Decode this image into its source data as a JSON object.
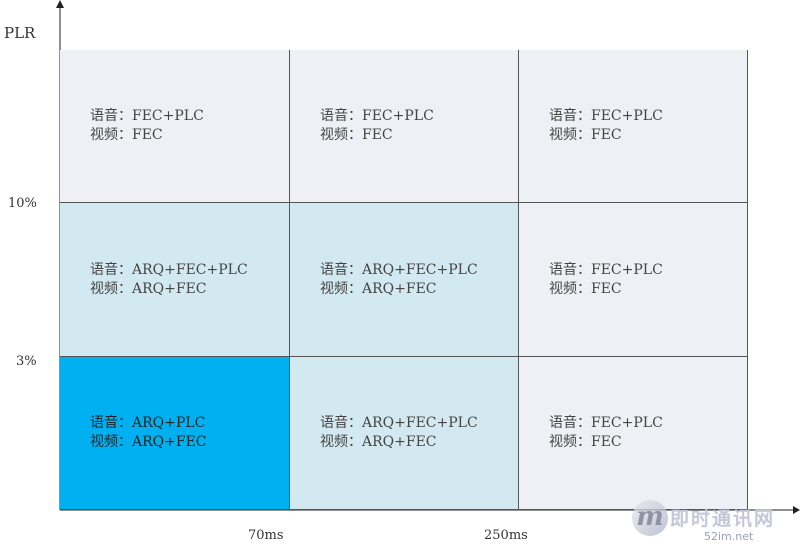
{
  "axes": {
    "y_title": "PLR",
    "y_ticks": [
      "10%",
      "3%"
    ],
    "x_ticks": [
      "70ms",
      "250ms"
    ]
  },
  "cells": [
    {
      "row": 0,
      "col": 0,
      "line1": "语音：FEC+PLC",
      "line2": "视频：FEC",
      "color": "#eef0f5"
    },
    {
      "row": 0,
      "col": 1,
      "line1": "语音：FEC+PLC",
      "line2": "视频：FEC",
      "color": "#eef0f5"
    },
    {
      "row": 0,
      "col": 2,
      "line1": "语音：FEC+PLC",
      "line2": "视频：FEC",
      "color": "#eef0f5"
    },
    {
      "row": 1,
      "col": 0,
      "line1": "语音：ARQ+FEC+PLC",
      "line2": "视频：ARQ+FEC",
      "color": "#d3e9f1"
    },
    {
      "row": 1,
      "col": 1,
      "line1": "语音：ARQ+FEC+PLC",
      "line2": "视频：ARQ+FEC",
      "color": "#d3e9f1"
    },
    {
      "row": 1,
      "col": 2,
      "line1": "语音：FEC+PLC",
      "line2": "视频：FEC",
      "color": "#eef0f5"
    },
    {
      "row": 2,
      "col": 0,
      "line1": "语音：ARQ+PLC",
      "line2": "视频：ARQ+FEC",
      "color": "#00b0f0"
    },
    {
      "row": 2,
      "col": 1,
      "line1": "语音：ARQ+FEC+PLC",
      "line2": "视频：ARQ+FEC",
      "color": "#d3e9f1"
    },
    {
      "row": 2,
      "col": 2,
      "line1": "语音：FEC+PLC",
      "line2": "视频：FEC",
      "color": "#eef0f5"
    }
  ],
  "watermark": {
    "logo_letter": "m",
    "name": "即时通讯网",
    "url": "52im.net"
  },
  "colors": {
    "axis": "#222222",
    "grid_line": "#555555"
  }
}
